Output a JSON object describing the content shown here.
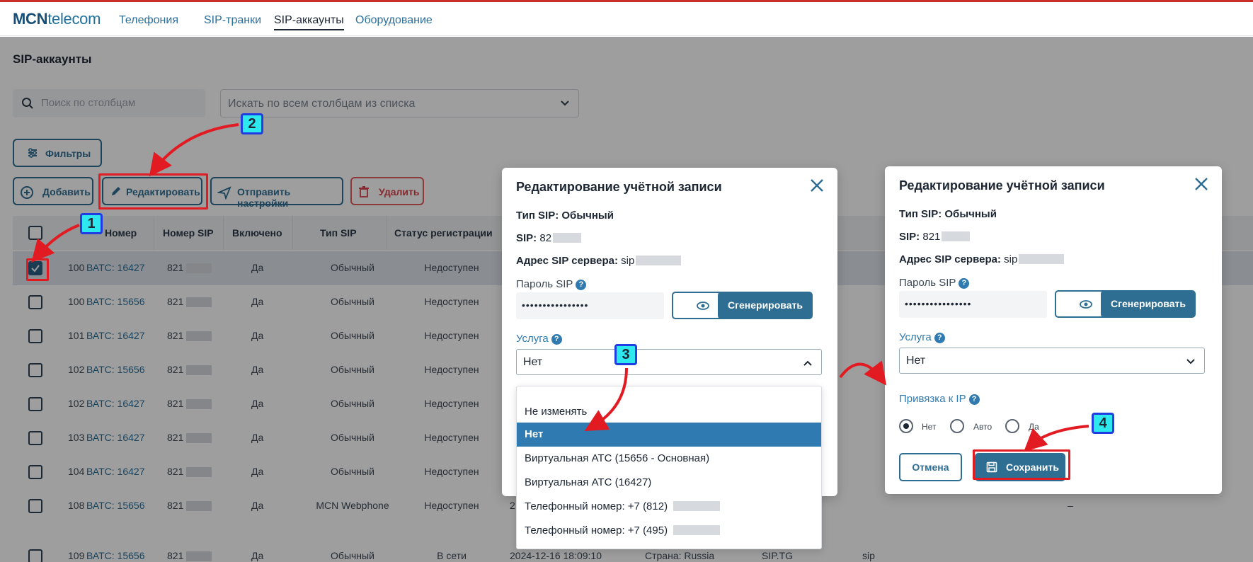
{
  "header": {
    "logo_bold": "MCN",
    "logo_rest": "telecom",
    "nav": [
      "Телефония",
      "SIP-транки",
      "SIP-аккаунты",
      "Оборудование"
    ]
  },
  "page": {
    "title": "SIP-аккаунты",
    "search_placeholder": "Поиск по столбцам",
    "columns_select_placeholder": "Искать по всем столбцам из списка"
  },
  "toolbar": {
    "filters": "Фильтры",
    "add": "Добавить",
    "edit": "Редактировать",
    "send_settings": "Отправить настройки",
    "delete": "Удалить"
  },
  "table": {
    "headers": [
      "Номер",
      "Номер SIP",
      "Включено",
      "Тип SIP",
      "Статус регистрации"
    ],
    "rows": [
      {
        "num": "100",
        "vats": "ВАТС: 16427",
        "sip": "821",
        "enabled": "Да",
        "type": "Обычный",
        "status": "Недоступен",
        "selected": true
      },
      {
        "num": "100",
        "vats": "ВАТС: 15656",
        "sip": "821",
        "enabled": "Да",
        "type": "Обычный",
        "status": "Недоступен"
      },
      {
        "num": "101",
        "vats": "ВАТС: 16427",
        "sip": "821",
        "enabled": "Да",
        "type": "Обычный",
        "status": "Недоступен"
      },
      {
        "num": "102",
        "vats": "ВАТС: 15656",
        "sip": "821",
        "enabled": "Да",
        "type": "Обычный",
        "status": "Недоступен"
      },
      {
        "num": "102",
        "vats": "ВАТС: 16427",
        "sip": "821",
        "enabled": "Да",
        "type": "Обычный",
        "status": "Недоступен"
      },
      {
        "num": "103",
        "vats": "ВАТС: 16427",
        "sip": "821",
        "enabled": "Да",
        "type": "Обычный",
        "status": "Недоступен"
      },
      {
        "num": "104",
        "vats": "ВАТС: 16427",
        "sip": "821",
        "enabled": "Да",
        "type": "Обычный",
        "status": "Недоступен"
      },
      {
        "num": "108",
        "vats": "ВАТС: 15656",
        "sip": "821",
        "enabled": "Да",
        "type": "MCN Webphone",
        "status": "Недоступен",
        "extra_date": "2",
        "extra_dash": "–"
      },
      {
        "num": "109",
        "vats": "ВАТС: 15656",
        "sip": "821",
        "enabled": "Да",
        "type": "Обычный",
        "status": "В сети",
        "extra_date": "2024-12-16 18:09:10",
        "extra_country": "Страна: Russia",
        "extra_server": "SIP.TG",
        "extra_sip": "sip"
      }
    ]
  },
  "modal_left": {
    "title": "Редактирование учётной записи",
    "sip_type_label": "Тип SIP:",
    "sip_type_value": "Обычный",
    "sip_label": "SIP:",
    "sip_value": "82",
    "server_label": "Адрес SIP сервера:",
    "server_value": "sip",
    "password_label": "Пароль SIP",
    "password_value": "••••••••••••••••",
    "generate": "Сгенерировать",
    "service_label": "Услуга",
    "service_value": "Нет",
    "options": [
      "Не изменять",
      "Нет",
      "Виртуальная АТС (15656 - Основная)",
      "Виртуальная АТС (16427)",
      "Телефонный номер: +7 (812)",
      "Телефонный номер: +7 (495)"
    ],
    "selected_option_index": 1
  },
  "modal_right": {
    "title": "Редактирование учётной записи",
    "sip_type_label": "Тип SIP:",
    "sip_type_value": "Обычный",
    "sip_label": "SIP:",
    "sip_value": "821",
    "server_label": "Адрес SIP сервера:",
    "server_value": "sip",
    "password_label": "Пароль SIP",
    "password_value": "••••••••••••••••",
    "generate": "Сгенерировать",
    "service_label": "Услуга",
    "service_value": "Нет",
    "ip_binding_label": "Привязка к IP",
    "ip_options": [
      "Нет",
      "Авто",
      "Да"
    ],
    "ip_selected": "Нет",
    "cancel": "Отмена",
    "save": "Сохранить"
  },
  "annotations": {
    "steps": [
      "1",
      "2",
      "3",
      "4"
    ],
    "color_box": "#e21b23",
    "color_callout_fill": "#2ee8f0",
    "color_callout_border": "#1f3de0"
  },
  "help_glyph": "?"
}
